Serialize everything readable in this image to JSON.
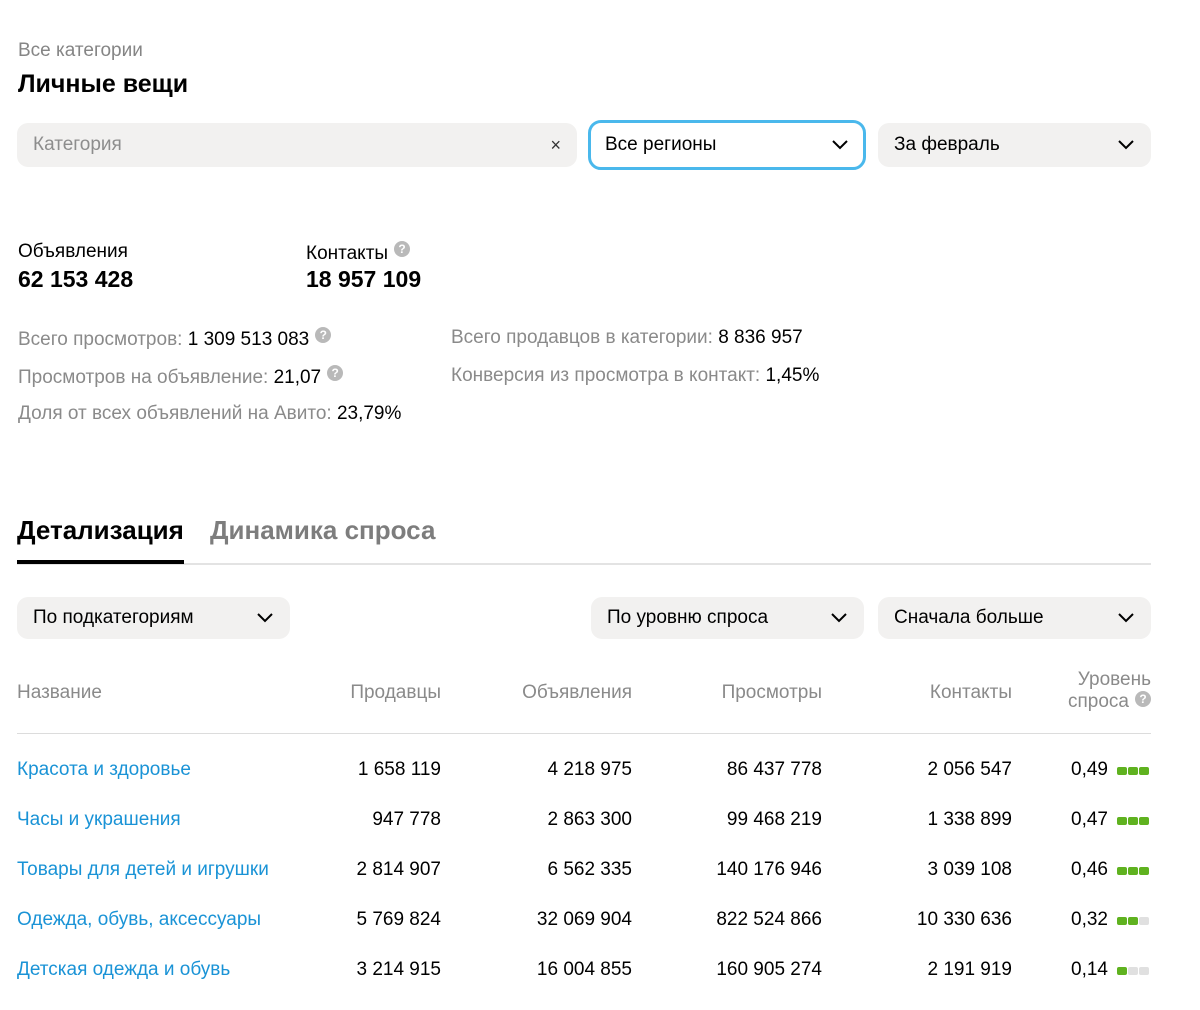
{
  "breadcrumb": "Все категории",
  "page_title": "Личные вещи",
  "filters": {
    "category_placeholder": "Категория",
    "clear_symbol": "×",
    "region_value": "Все регионы",
    "period_value": "За февраль"
  },
  "stats": {
    "ads_label": "Объявления",
    "ads_value": "62 153 428",
    "contacts_label": "Контакты",
    "contacts_value": "18 957 109"
  },
  "metrics": {
    "views_total_label": "Всего просмотров:",
    "views_total_value": "1 309 513 083",
    "views_per_ad_label": "Просмотров на объявление:",
    "views_per_ad_value": "21,07",
    "share_label": "Доля от всех объявлений на Авито:",
    "share_value": "23,79%",
    "sellers_label": "Всего продавцов в категории:",
    "sellers_value": "8 836 957",
    "conversion_label": "Конверсия из просмотра в контакт:",
    "conversion_value": "1,45%"
  },
  "tabs": [
    "Детализация",
    "Динамика спроса"
  ],
  "table_controls": {
    "grouping": "По подкатегориям",
    "sort_by": "По уровню спроса",
    "order": "Сначала больше"
  },
  "table": {
    "headers": {
      "name": "Название",
      "sellers": "Продавцы",
      "ads": "Объявления",
      "views": "Просмотры",
      "contacts": "Контакты",
      "demand_line1": "Уровень",
      "demand_line2": "спроса"
    },
    "rows": [
      {
        "name": "Красота и здоровье",
        "sellers": "1 658 119",
        "ads": "4 218 975",
        "views": "86 437 778",
        "contacts": "2 056 547",
        "demand": "0,49",
        "demand_level": 3
      },
      {
        "name": "Часы и украшения",
        "sellers": "947 778",
        "ads": "2 863 300",
        "views": "99 468 219",
        "contacts": "1 338 899",
        "demand": "0,47",
        "demand_level": 3
      },
      {
        "name": "Товары для детей и игрушки",
        "sellers": "2 814 907",
        "ads": "6 562 335",
        "views": "140 176 946",
        "contacts": "3 039 108",
        "demand": "0,46",
        "demand_level": 3
      },
      {
        "name": "Одежда, обувь, аксессуары",
        "sellers": "5 769 824",
        "ads": "32 069 904",
        "views": "822 524 866",
        "contacts": "10 330 636",
        "demand": "0,32",
        "demand_level": 2
      },
      {
        "name": "Детская одежда и обувь",
        "sellers": "3 214 915",
        "ads": "16 004 855",
        "views": "160 905 274",
        "contacts": "2 191 919",
        "demand": "0,14",
        "demand_level": 1
      }
    ]
  },
  "icons": {
    "help": "?",
    "chevron": "chevron-down-icon"
  },
  "colors": {
    "accent_link": "#1a93d6",
    "focus_border": "#4ab8ec",
    "demand_on": "#5fb21f",
    "demand_off": "#e0e0e0"
  }
}
